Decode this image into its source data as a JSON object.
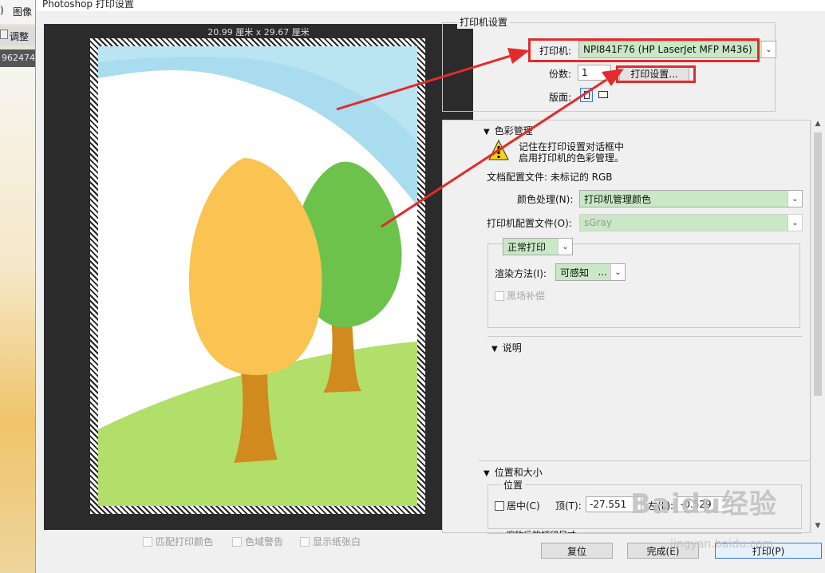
{
  "background_app": {
    "top_label": "图像",
    "row2_label": "调整",
    "row3_label": "962474"
  },
  "dialog": {
    "title": "Photoshop 打印设置",
    "preview": {
      "dimensions": "20.99 厘米 x 29.67 厘米"
    },
    "preview_options": [
      {
        "label": "匹配打印颜色"
      },
      {
        "label": "色域警告"
      },
      {
        "label": "显示纸张白"
      }
    ],
    "printer_settings": {
      "group_title": "打印机设置",
      "printer_label": "打印机:",
      "printer_value": "NPI841F76 (HP LaserJet MFP M436)",
      "copies_label": "份数:",
      "copies_value": "1",
      "print_settings_button": "打印设置...",
      "layout_label": "版面:"
    },
    "color_management": {
      "section_title": "色彩管理",
      "warning_line1": "记住在打印设置对话框中",
      "warning_line2": "启用打印机的色彩管理。",
      "doc_profile": "文档配置文件: 未标记的 RGB",
      "color_handling_label": "颜色处理(N):",
      "color_handling_value": "打印机管理颜色",
      "printer_profile_label": "打印机配置文件(O):",
      "printer_profile_value": "sGray",
      "print_mode_value": "正常打印",
      "rendering_intent_label": "渲染方法(I):",
      "rendering_intent_value": "可感知",
      "rendering_intent_ellipsis": "...",
      "black_point_label": "黑场补偿"
    },
    "description": {
      "section_title": "说明"
    },
    "position_size": {
      "section_title": "位置和大小",
      "position_group": "位置",
      "center_label": "居中(C)",
      "top_label": "顶(T):",
      "top_value": "-27.551",
      "left_label": "左(L):",
      "left_value": "-0.529",
      "scaled_group": "缩放后的打印尺寸"
    },
    "footer": {
      "reset": "复位",
      "done": "完成(E)",
      "print": "打印(P)"
    }
  },
  "watermark": {
    "brand": "Baidu经验",
    "url": "jingyan.baidu.com"
  },
  "colors": {
    "highlight_red": "#e32b2b",
    "selection_green": "#c9e8c6",
    "preview_bg": "#2b2b2b"
  }
}
